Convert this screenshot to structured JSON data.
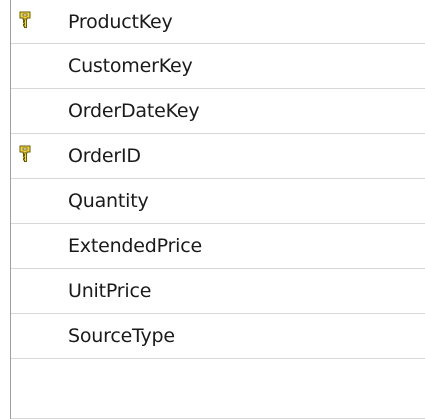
{
  "columns": [
    {
      "name": "ProductKey",
      "is_key": true
    },
    {
      "name": "CustomerKey",
      "is_key": false
    },
    {
      "name": "OrderDateKey",
      "is_key": false
    },
    {
      "name": "OrderID",
      "is_key": true
    },
    {
      "name": "Quantity",
      "is_key": false
    },
    {
      "name": "ExtendedPrice",
      "is_key": false
    },
    {
      "name": "UnitPrice",
      "is_key": false
    },
    {
      "name": "SourceType",
      "is_key": false
    }
  ],
  "icons": {
    "key": "key-icon"
  },
  "colors": {
    "key_fill": "#f2d64b",
    "key_outline": "#6b5a00",
    "grid_line": "#d8d8d8"
  }
}
